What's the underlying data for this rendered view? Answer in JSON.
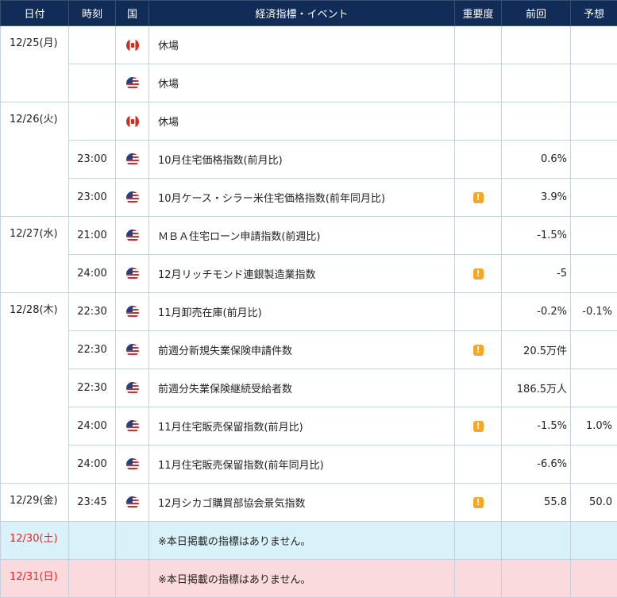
{
  "headers": {
    "date": "日付",
    "time": "時刻",
    "country": "国",
    "event": "経済指標・イベント",
    "importance": "重要度",
    "previous": "前回",
    "forecast": "予想"
  },
  "colors": {
    "header_bg": "#122c58",
    "saturday_bg": "#d9f2f9",
    "sunday_bg": "#fbdadd",
    "weekend_date_text": "#e22222",
    "importance_icon": "#f5a623"
  },
  "rows": [
    {
      "date": "12/25(月)",
      "time": "",
      "country": "canada-flag-icon",
      "event": "休場",
      "importance": "",
      "previous": "",
      "forecast": ""
    },
    {
      "date": "",
      "time": "",
      "country": "usa-flag-icon",
      "event": "休場",
      "importance": "",
      "previous": "",
      "forecast": ""
    },
    {
      "date": "12/26(火)",
      "time": "",
      "country": "canada-flag-icon",
      "event": "休場",
      "importance": "",
      "previous": "",
      "forecast": ""
    },
    {
      "date": "",
      "time": "23:00",
      "country": "usa-flag-icon",
      "event": "10月住宅価格指数(前月比)",
      "importance": "",
      "previous": "0.6%",
      "forecast": ""
    },
    {
      "date": "",
      "time": "23:00",
      "country": "usa-flag-icon",
      "event": "10月ケース・シラー米住宅価格指数(前年同月比)",
      "importance": "!",
      "previous": "3.9%",
      "forecast": ""
    },
    {
      "date": "12/27(水)",
      "time": "21:00",
      "country": "usa-flag-icon",
      "event": "ＭＢＡ住宅ローン申請指数(前週比)",
      "importance": "",
      "previous": "-1.5%",
      "forecast": ""
    },
    {
      "date": "",
      "time": "24:00",
      "country": "usa-flag-icon",
      "event": "12月リッチモンド連銀製造業指数",
      "importance": "!",
      "previous": "-5",
      "forecast": ""
    },
    {
      "date": "12/28(木)",
      "time": "22:30",
      "country": "usa-flag-icon",
      "event": "11月卸売在庫(前月比)",
      "importance": "",
      "previous": "-0.2%",
      "forecast": "-0.1%"
    },
    {
      "date": "",
      "time": "22:30",
      "country": "usa-flag-icon",
      "event": "前週分新規失業保険申請件数",
      "importance": "!",
      "previous": "20.5万件",
      "forecast": ""
    },
    {
      "date": "",
      "time": "22:30",
      "country": "usa-flag-icon",
      "event": "前週分失業保険継続受給者数",
      "importance": "",
      "previous": "186.5万人",
      "forecast": ""
    },
    {
      "date": "",
      "time": "24:00",
      "country": "usa-flag-icon",
      "event": "11月住宅販売保留指数(前月比)",
      "importance": "!",
      "previous": "-1.5%",
      "forecast": "1.0%"
    },
    {
      "date": "",
      "time": "24:00",
      "country": "usa-flag-icon",
      "event": "11月住宅販売保留指数(前年同月比)",
      "importance": "",
      "previous": "-6.6%",
      "forecast": ""
    },
    {
      "date": "12/29(金)",
      "time": "23:45",
      "country": "usa-flag-icon",
      "event": "12月シカゴ購買部協会景気指数",
      "importance": "!",
      "previous": "55.8",
      "forecast": "50.0"
    },
    {
      "date": "12/30(土)",
      "time": "",
      "country": "",
      "event": "※本日掲載の指標はありません。",
      "importance": "",
      "previous": "",
      "forecast": ""
    },
    {
      "date": "12/31(日)",
      "time": "",
      "country": "",
      "event": "※本日掲載の指標はありません。",
      "importance": "",
      "previous": "",
      "forecast": ""
    }
  ]
}
